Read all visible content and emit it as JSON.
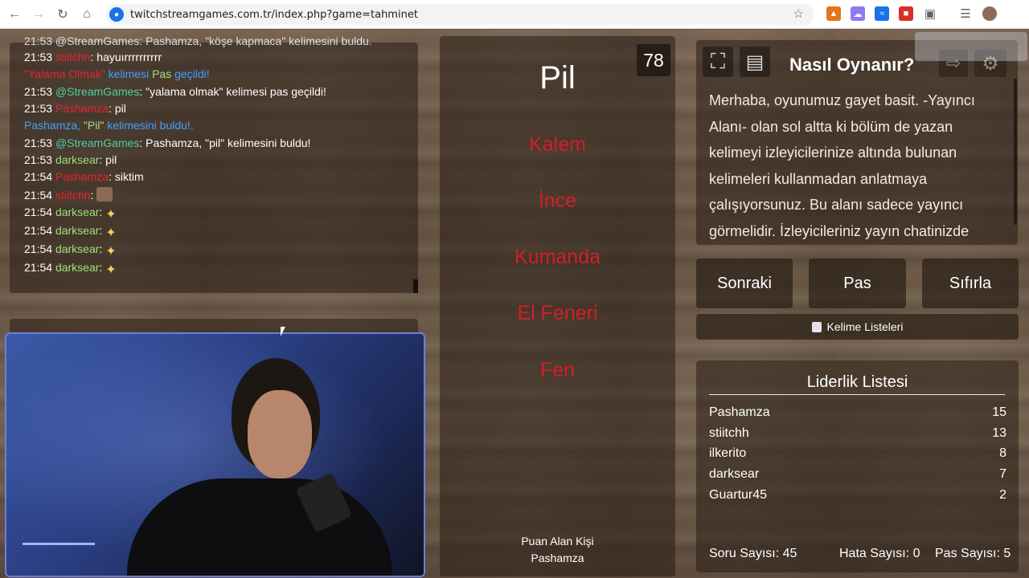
{
  "browser": {
    "url": "twitchstreamgames.com.tr/index.php?game=tahminet"
  },
  "chat": {
    "partial_top": "21:53 @StreamGames: Pashamza, \"köşe kapmaca\" kelimesini buldu.",
    "lines": [
      {
        "ts": "21:53",
        "user": "stiitchh",
        "user_color": "#e8232d",
        "text": ": hayuırrrrrrrrrr"
      },
      {
        "ts": "",
        "user": "",
        "user_color": "",
        "text": ""
      },
      {
        "ts": "21:53",
        "user": "@StreamGames",
        "user_color": "#9fe07a",
        "text": ": \"yalama olmak\" kelimesi pas geçildi!"
      },
      {
        "ts": "21:53",
        "user": "Pashamza",
        "user_color": "#e8232d",
        "text": ": pil"
      },
      {
        "ts": "",
        "user": "",
        "user_color": "",
        "text": ""
      },
      {
        "ts": "21:53",
        "user": "@StreamGames",
        "user_color": "#9fe07a",
        "text": ": Pashamza, \"pil\" kelimesini buldu!"
      },
      {
        "ts": "21:53",
        "user": "darksear",
        "user_color": "#9fe07a",
        "text": ": pil"
      },
      {
        "ts": "21:54",
        "user": "Pashamza",
        "user_color": "#e8232d",
        "text": ": siktim"
      },
      {
        "ts": "21:54",
        "user": "stiitchh",
        "user_color": "#e8232d",
        "text": ":"
      },
      {
        "ts": "21:54",
        "user": "darksear",
        "user_color": "#9fe07a",
        "text": ":"
      },
      {
        "ts": "21:54",
        "user": "darksear",
        "user_color": "#9fe07a",
        "text": ":"
      },
      {
        "ts": "21:54",
        "user": "darksear",
        "user_color": "#9fe07a",
        "text": ":"
      },
      {
        "ts": "21:54",
        "user": "darksear",
        "user_color": "#9fe07a",
        "text": ":"
      }
    ],
    "pass_notice": {
      "word": "\"Yalama Olmak\"",
      "mid": " kelimesi ",
      "pas": "Pas",
      "end": " geçildi!"
    },
    "found_notice": {
      "who": "Pashamza, ",
      "word": "\"Pil\"",
      "end": " kelimesini buldu!."
    }
  },
  "game": {
    "timer": "78",
    "main_word": "Pil",
    "forbidden": [
      "Kalem",
      "İnce",
      "Kumanda",
      "El Feneri",
      "Fen"
    ],
    "scorer_label": "Puan Alan Kişi",
    "scorer_name": "Pashamza"
  },
  "howto": {
    "title": "Nasıl Oynanır?",
    "body": "Merhaba, oyunumuz gayet basit. -Yayıncı Alanı- olan sol altta ki bölüm de yazan kelimeyi izleyicilerinize altında bulunan kelimeleri kullanmadan anlatmaya çalışıyorsunuz. Bu alanı sadece yayıncı görmelidir. İzleyicileriniz yayın chatinizde"
  },
  "controls": {
    "next": "Sonraki",
    "pass": "Pas",
    "reset": "Sıfırla",
    "word_lists": "Kelime Listeleri"
  },
  "leaderboard": {
    "title": "Liderlik Listesi",
    "rows": [
      {
        "name": "Pashamza",
        "score": "15"
      },
      {
        "name": "stiitchh",
        "score": "13"
      },
      {
        "name": "ilkerito",
        "score": "8"
      },
      {
        "name": "darksear",
        "score": "7"
      },
      {
        "name": "Guartur45",
        "score": "2"
      }
    ],
    "stats": {
      "questions": "Soru Sayısı: 45",
      "errors": "Hata Sayısı: 0",
      "passes": "Pas Sayısı: 5"
    }
  },
  "colors": {
    "accent_red": "#d21f2a",
    "chat_green": "#9fe07a",
    "chat_blue": "#3fa0ff"
  }
}
